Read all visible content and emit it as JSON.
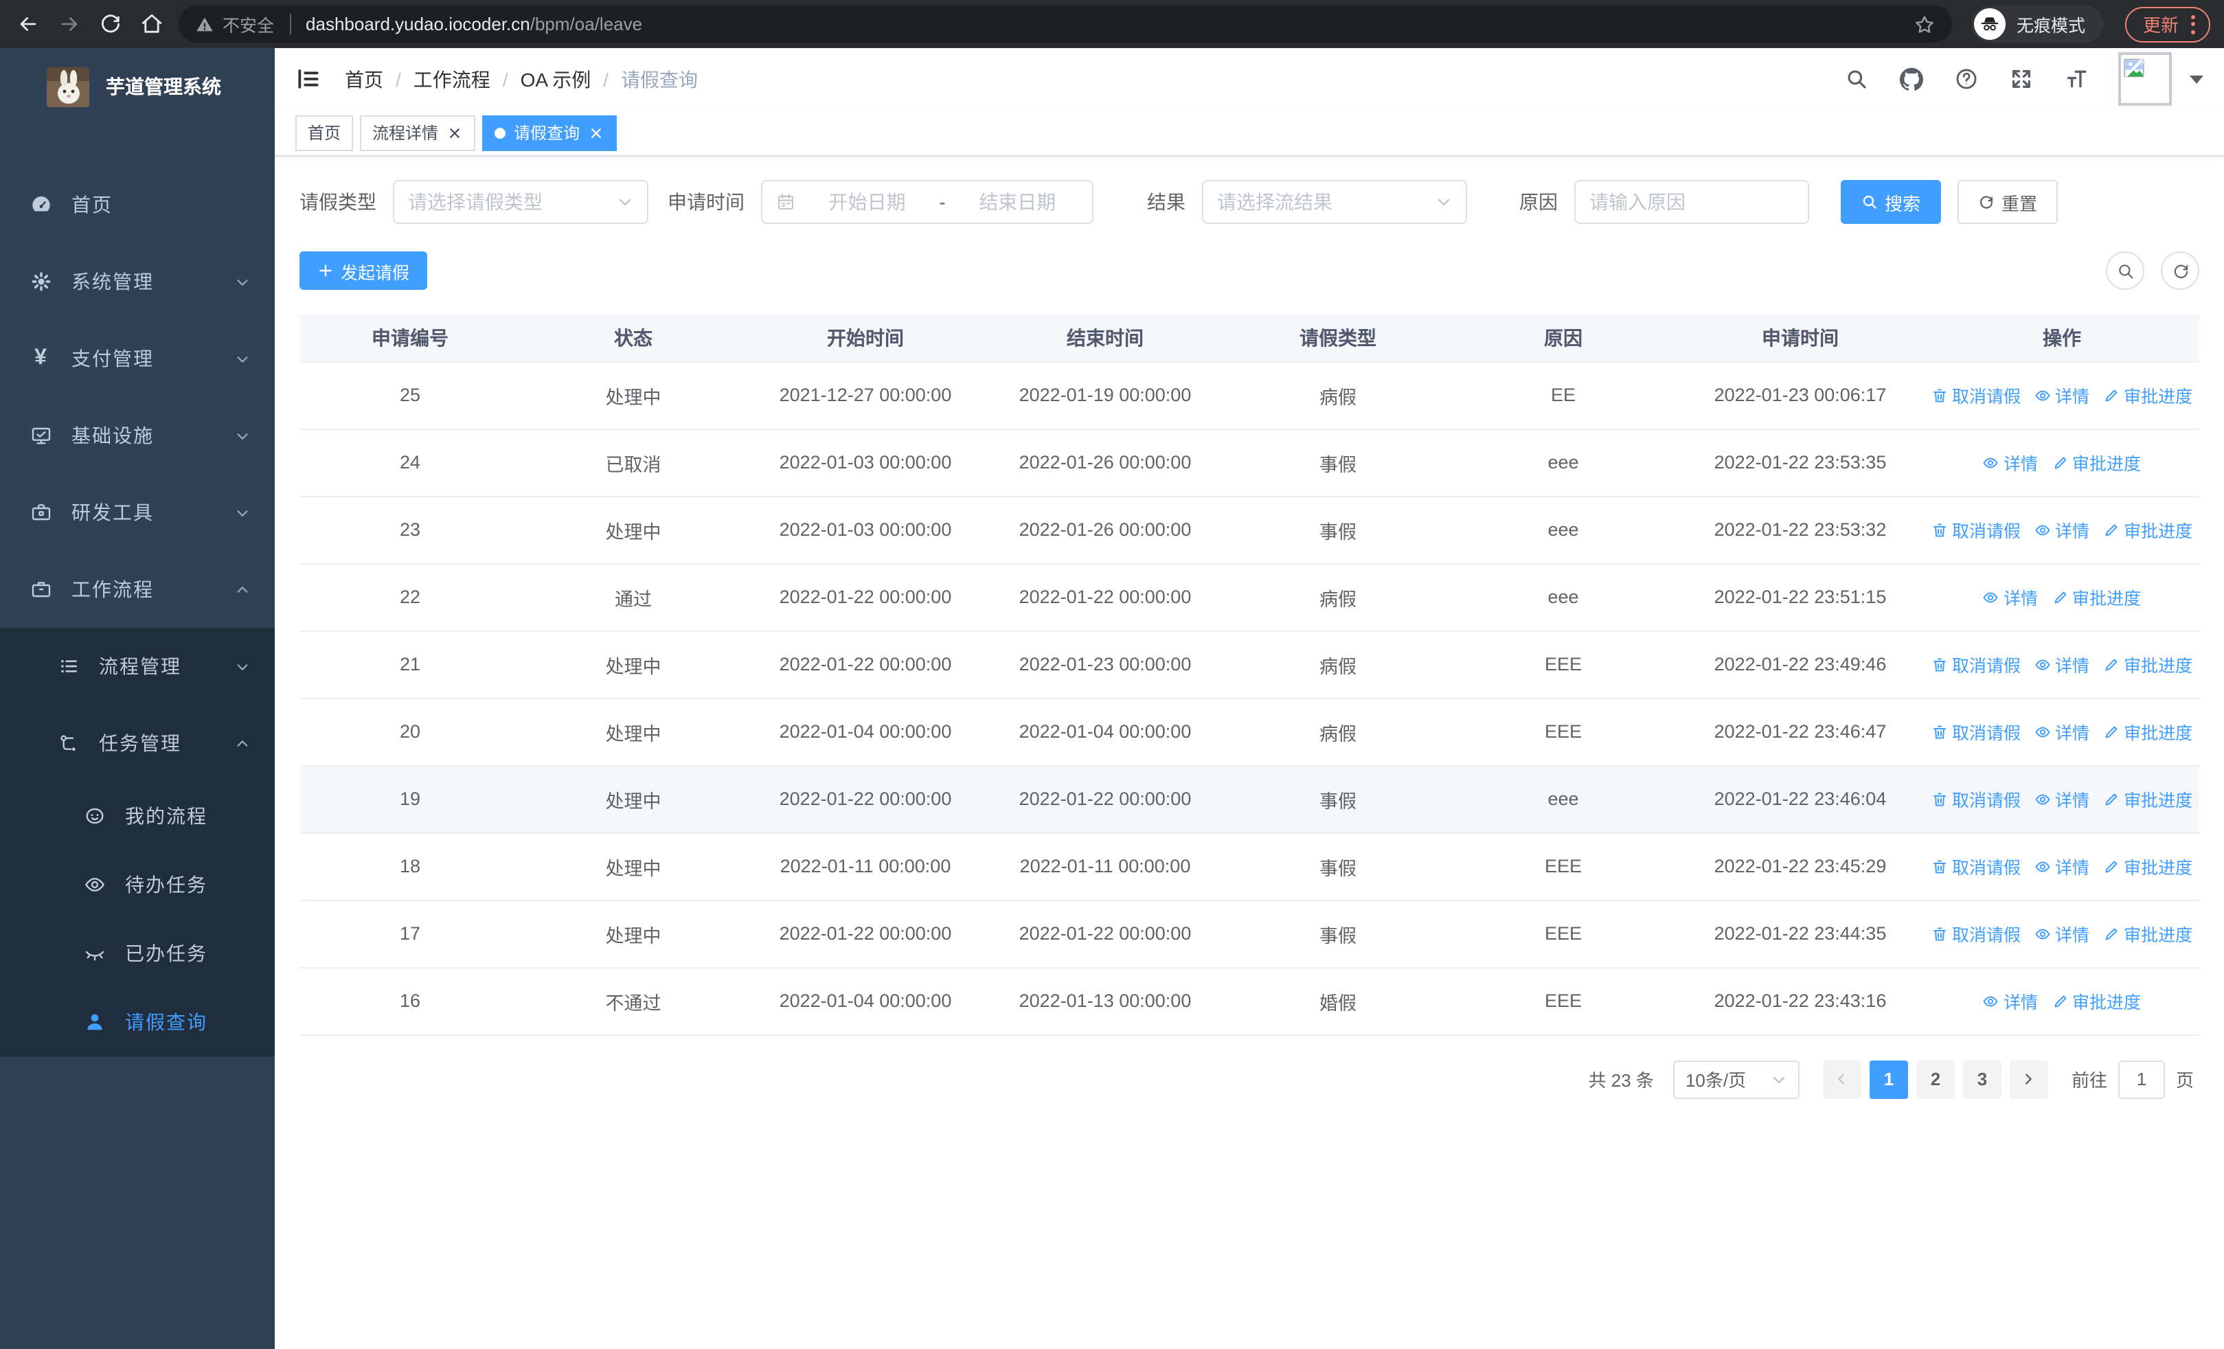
{
  "browser": {
    "security_label": "不安全",
    "url_host": "dashboard.yudao.iocoder.cn",
    "url_path": "/bpm/oa/leave",
    "incognito_label": "无痕模式",
    "update_label": "更新"
  },
  "colors": {
    "primary": "#409eff",
    "sidebar_bg": "#304156",
    "submenu_bg": "#1f2d3d",
    "update_accent": "#ee8277"
  },
  "sidebar": {
    "title": "芋道管理系统",
    "items": [
      {
        "label": "首页",
        "icon": "dashboard-icon"
      },
      {
        "label": "系统管理",
        "icon": "gear-icon",
        "state": "collapsed"
      },
      {
        "label": "支付管理",
        "icon": "yen-icon",
        "state": "collapsed",
        "glyph": "¥"
      },
      {
        "label": "基础设施",
        "icon": "monitor-icon",
        "state": "collapsed"
      },
      {
        "label": "研发工具",
        "icon": "toolbox-icon",
        "state": "collapsed"
      },
      {
        "label": "工作流程",
        "icon": "briefcase-icon",
        "state": "expanded",
        "children": [
          {
            "label": "流程管理",
            "icon": "list-tree-icon",
            "state": "collapsed"
          },
          {
            "label": "任务管理",
            "icon": "workflow-icon",
            "state": "expanded",
            "children": [
              {
                "label": "我的流程",
                "icon": "face-icon"
              },
              {
                "label": "待办任务",
                "icon": "eye-icon"
              },
              {
                "label": "已办任务",
                "icon": "eye-closed-icon"
              },
              {
                "label": "请假查询",
                "icon": "user-icon",
                "active": true
              }
            ]
          }
        ]
      }
    ]
  },
  "header": {
    "breadcrumb": [
      "首页",
      "工作流程",
      "OA 示例",
      "请假查询"
    ]
  },
  "tabs": [
    {
      "label": "首页",
      "closable": false,
      "active": false
    },
    {
      "label": "流程详情",
      "closable": true,
      "active": false
    },
    {
      "label": "请假查询",
      "closable": true,
      "active": true
    }
  ],
  "filters": {
    "leave_type_label": "请假类型",
    "leave_type_placeholder": "请选择请假类型",
    "apply_time_label": "申请时间",
    "start_date_placeholder": "开始日期",
    "date_separator": "-",
    "end_date_placeholder": "结束日期",
    "result_label": "结果",
    "result_placeholder": "请选择流结果",
    "reason_label": "原因",
    "reason_placeholder": "请输入原因",
    "search_label": "搜索",
    "reset_label": "重置"
  },
  "toolbar": {
    "create_label": "发起请假"
  },
  "table": {
    "columns": [
      "申请编号",
      "状态",
      "开始时间",
      "结束时间",
      "请假类型",
      "原因",
      "申请时间",
      "操作"
    ],
    "action_labels": {
      "cancel": "取消请假",
      "detail": "详情",
      "progress": "审批进度"
    },
    "rows": [
      {
        "id": "25",
        "status": "处理中",
        "start": "2021-12-27 00:00:00",
        "end": "2022-01-19 00:00:00",
        "type": "病假",
        "reason": "EE",
        "applyTime": "2022-01-23 00:06:17",
        "actions": [
          "cancel",
          "detail",
          "progress"
        ],
        "highlight": false
      },
      {
        "id": "24",
        "status": "已取消",
        "start": "2022-01-03 00:00:00",
        "end": "2022-01-26 00:00:00",
        "type": "事假",
        "reason": "eee",
        "applyTime": "2022-01-22 23:53:35",
        "actions": [
          "detail",
          "progress"
        ],
        "highlight": false
      },
      {
        "id": "23",
        "status": "处理中",
        "start": "2022-01-03 00:00:00",
        "end": "2022-01-26 00:00:00",
        "type": "事假",
        "reason": "eee",
        "applyTime": "2022-01-22 23:53:32",
        "actions": [
          "cancel",
          "detail",
          "progress"
        ],
        "highlight": false
      },
      {
        "id": "22",
        "status": "通过",
        "start": "2022-01-22 00:00:00",
        "end": "2022-01-22 00:00:00",
        "type": "病假",
        "reason": "eee",
        "applyTime": "2022-01-22 23:51:15",
        "actions": [
          "detail",
          "progress"
        ],
        "highlight": false
      },
      {
        "id": "21",
        "status": "处理中",
        "start": "2022-01-22 00:00:00",
        "end": "2022-01-23 00:00:00",
        "type": "病假",
        "reason": "EEE",
        "applyTime": "2022-01-22 23:49:46",
        "actions": [
          "cancel",
          "detail",
          "progress"
        ],
        "highlight": false
      },
      {
        "id": "20",
        "status": "处理中",
        "start": "2022-01-04 00:00:00",
        "end": "2022-01-04 00:00:00",
        "type": "病假",
        "reason": "EEE",
        "applyTime": "2022-01-22 23:46:47",
        "actions": [
          "cancel",
          "detail",
          "progress"
        ],
        "highlight": false
      },
      {
        "id": "19",
        "status": "处理中",
        "start": "2022-01-22 00:00:00",
        "end": "2022-01-22 00:00:00",
        "type": "事假",
        "reason": "eee",
        "applyTime": "2022-01-22 23:46:04",
        "actions": [
          "cancel",
          "detail",
          "progress"
        ],
        "highlight": true
      },
      {
        "id": "18",
        "status": "处理中",
        "start": "2022-01-11 00:00:00",
        "end": "2022-01-11 00:00:00",
        "type": "事假",
        "reason": "EEE",
        "applyTime": "2022-01-22 23:45:29",
        "actions": [
          "cancel",
          "detail",
          "progress"
        ],
        "highlight": false
      },
      {
        "id": "17",
        "status": "处理中",
        "start": "2022-01-22 00:00:00",
        "end": "2022-01-22 00:00:00",
        "type": "事假",
        "reason": "EEE",
        "applyTime": "2022-01-22 23:44:35",
        "actions": [
          "cancel",
          "detail",
          "progress"
        ],
        "highlight": false
      },
      {
        "id": "16",
        "status": "不通过",
        "start": "2022-01-04 00:00:00",
        "end": "2022-01-13 00:00:00",
        "type": "婚假",
        "reason": "EEE",
        "applyTime": "2022-01-22 23:43:16",
        "actions": [
          "detail",
          "progress"
        ],
        "highlight": false
      }
    ]
  },
  "pagination": {
    "total_label": "共 23 条",
    "page_size": "10条/页",
    "pages": [
      "1",
      "2",
      "3"
    ],
    "active_page": "1",
    "goto_label": "前往",
    "goto_value": "1",
    "page_unit": "页"
  }
}
